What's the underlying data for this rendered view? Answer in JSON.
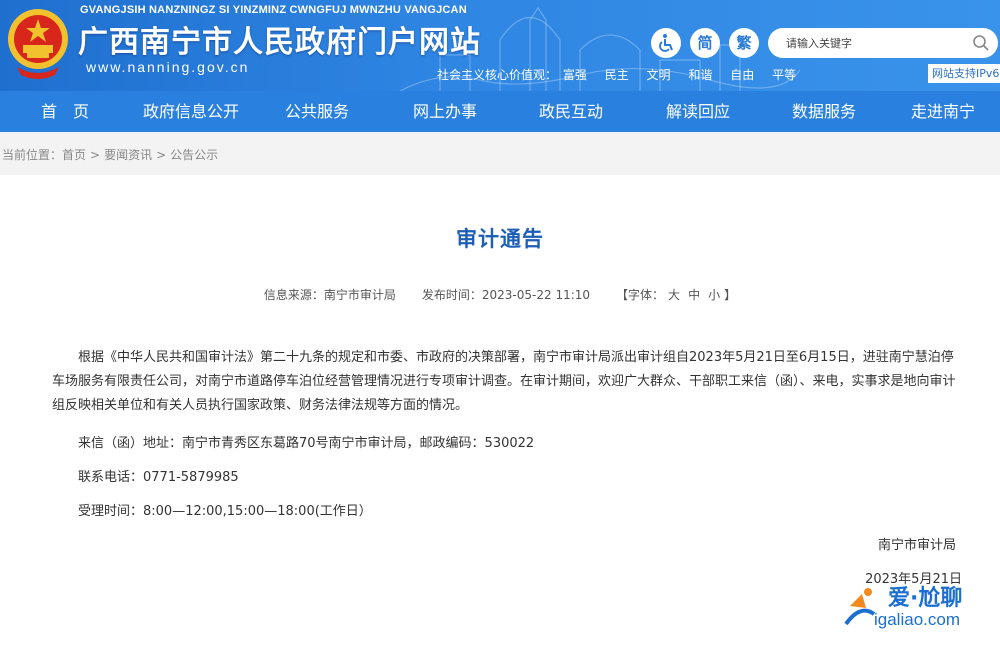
{
  "header": {
    "zhuang_name": "GVANGJSIH NANZNINGZ SI YINZMINZ CWNGFUJ MWNZHU VANGJCAN",
    "title": "广西南宁市人民政府门户网站",
    "url": "www.nanning.gov.cn",
    "accessibility_icon": "wheelchair-icon",
    "simplified_label": "简",
    "traditional_label": "繁",
    "search_placeholder": "请输入关键字",
    "search_icon": "search-icon",
    "values_label": "社会主义核心价值观：",
    "values": [
      "富强",
      "民主",
      "文明",
      "和谐",
      "自由",
      "平等"
    ],
    "ipv6": "网站支持IPv6",
    "bg_color": "#2f86e3"
  },
  "nav": {
    "items": [
      "首　页",
      "政府信息公开",
      "公共服务",
      "网上办事",
      "政民互动",
      "解读回应",
      "数据服务",
      "走进南宁"
    ]
  },
  "breadcrumb": {
    "label": "当前位置：",
    "items": [
      "首页",
      "要闻资讯",
      "公告公示"
    ],
    "separator": ">"
  },
  "article": {
    "title": "审计通告",
    "source": "信息来源：南宁市审计局",
    "publish_time": "发布时间：2023-05-22 11:10",
    "font_size_label": "【字体：",
    "font_sizes": [
      "大",
      "中",
      "小"
    ],
    "font_size_close": "】",
    "paragraph": "根据《中华人民共和国审计法》第二十九条的规定和市委、市政府的决策部署，南宁市审计局派出审计组自2023年5月21日至6月15日，进驻南宁慧泊停车场服务有限责任公司，对南宁市道路停车泊位经营管理情况进行专项审计调查。在审计期间，欢迎广大群众、干部职工来信（函）、来电，实事求是地向审计组反映相关单位和有关人员执行国家政策、财务法律法规等方面的情况。",
    "address": "来信（函）地址：南宁市青秀区东葛路70号南宁市审计局，邮政编码：530022",
    "phone": "联系电话：0771-5879985",
    "hours": "受理时间：8:00—12:00,15:00—18:00(工作日）",
    "signature": "南宁市审计局",
    "date": "2023年5月21日",
    "title_color": "#1e5fb6"
  },
  "watermark": {
    "text": "爱·尬聊",
    "domain": "igaliao.com"
  }
}
